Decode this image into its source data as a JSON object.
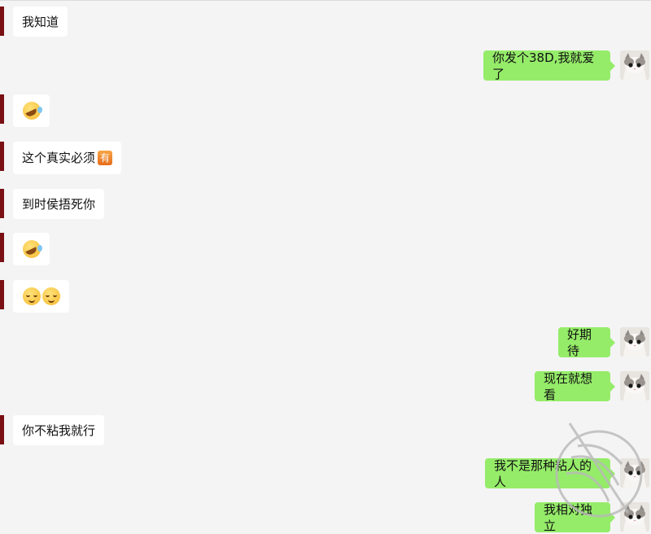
{
  "colors": {
    "background": "#f4f4f4",
    "incoming_bubble": "#ffffff",
    "outgoing_bubble": "#95ec69",
    "left_marker": "#7a0f14"
  },
  "messages": [
    {
      "side": "incoming",
      "text": "我知道"
    },
    {
      "side": "outgoing",
      "text": "你发个38D,我就爱了"
    },
    {
      "side": "incoming",
      "emoji": [
        "rolling-on-floor-laughing"
      ]
    },
    {
      "side": "incoming",
      "text": "这个真实必须",
      "badge": "有"
    },
    {
      "side": "incoming",
      "text": "到时侯捂死你"
    },
    {
      "side": "incoming",
      "emoji": [
        "rolling-on-floor-laughing"
      ]
    },
    {
      "side": "incoming",
      "emoji": [
        "relieved-face",
        "relieved-face"
      ]
    },
    {
      "side": "outgoing",
      "text": "好期待"
    },
    {
      "side": "outgoing",
      "text": "现在就想看"
    },
    {
      "side": "incoming",
      "text": "你不粘我就行"
    },
    {
      "side": "outgoing",
      "text": "我不是那种粘人的人"
    },
    {
      "side": "outgoing",
      "text": "我相对独立"
    }
  ]
}
